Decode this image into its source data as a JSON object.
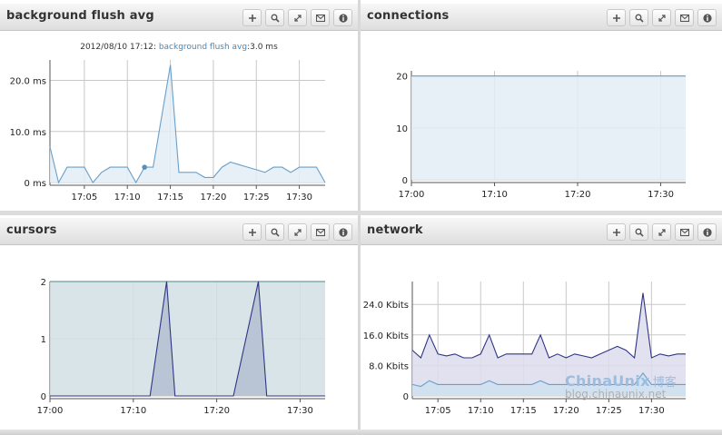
{
  "panels": {
    "flush": {
      "title": "background flush avg"
    },
    "connections": {
      "title": "connections"
    },
    "cursors": {
      "title": "cursors"
    },
    "network": {
      "title": "network"
    }
  },
  "tooltip": {
    "timestamp": "2012/08/10 17:12:",
    "series": "background flush avg",
    "value": ":3.0 ms"
  },
  "watermark": {
    "brand": "ChinaUnix",
    "brand_cn": "博客",
    "url": "blog.chinaunix.net"
  },
  "chart_data": [
    {
      "id": "flush",
      "type": "area",
      "title": "background flush avg",
      "color": "#6a9fc9",
      "fill": "#e3edf6",
      "x_ticks": [
        "17:05",
        "17:10",
        "17:15",
        "17:20",
        "17:25",
        "17:30"
      ],
      "y_ticks": [
        "0 ms",
        "10.0 ms",
        "20.0 ms"
      ],
      "ylim": [
        0,
        24
      ],
      "x": [
        0,
        1,
        2,
        3,
        4,
        5,
        6,
        7,
        8,
        9,
        10,
        11,
        12,
        13,
        14,
        15,
        16,
        17,
        18,
        19,
        20,
        21,
        22,
        23,
        24,
        25,
        26,
        27,
        28,
        29,
        30,
        31,
        32
      ],
      "values": [
        7,
        0,
        3,
        3,
        3,
        0,
        2,
        3,
        3,
        3,
        0,
        3,
        3,
        13,
        23,
        2,
        2,
        2,
        1,
        1,
        3,
        4,
        3.5,
        3,
        2.5,
        2,
        3,
        3,
        2,
        3,
        3,
        3,
        0
      ],
      "highlight": {
        "x": 11,
        "y": 3
      }
    },
    {
      "id": "connections",
      "type": "area",
      "title": "connections",
      "color": "#6a9fc9",
      "fill": "#e3edf6",
      "x_ticks": [
        "17:00",
        "17:10",
        "17:20",
        "17:30"
      ],
      "y_ticks": [
        "0",
        "10",
        "20"
      ],
      "ylim": [
        0,
        21
      ],
      "x": [
        0,
        33
      ],
      "values": [
        20,
        20
      ]
    },
    {
      "id": "cursors",
      "type": "area",
      "title": "cursors",
      "x_ticks": [
        "17:00",
        "17:10",
        "17:20",
        "17:30"
      ],
      "y_ticks": [
        "0",
        "1",
        "2"
      ],
      "ylim": [
        0,
        2
      ],
      "series": [
        {
          "color": "#4f8a8a",
          "fill": "#d1dfe3",
          "x": [
            0,
            33
          ],
          "values": [
            2,
            2
          ]
        },
        {
          "color": "#2f3584",
          "fill": "#b4bfd0",
          "x": [
            0,
            12,
            14,
            15,
            22,
            25,
            26,
            33
          ],
          "values": [
            0,
            0,
            2,
            0,
            0,
            2,
            0,
            0
          ]
        }
      ]
    },
    {
      "id": "network",
      "type": "area",
      "title": "network",
      "x_ticks": [
        "17:05",
        "17:10",
        "17:15",
        "17:20",
        "17:25",
        "17:30"
      ],
      "y_ticks": [
        "0",
        "8.0 Kbits",
        "16.0 Kbits",
        "24.0 Kbits"
      ],
      "ylim": [
        0,
        30
      ],
      "series": [
        {
          "color": "#2f3584",
          "fill": "#dcdcec",
          "x": [
            0,
            1,
            2,
            3,
            4,
            5,
            6,
            7,
            8,
            9,
            10,
            11,
            12,
            13,
            14,
            15,
            16,
            17,
            18,
            19,
            20,
            21,
            22,
            23,
            24,
            25,
            26,
            27,
            28,
            29,
            30,
            31,
            32
          ],
          "values": [
            12,
            10,
            16,
            11,
            10.5,
            11,
            10,
            10,
            11,
            16,
            10,
            11,
            11,
            11,
            11,
            16,
            10,
            11,
            10,
            11,
            10.5,
            10,
            11,
            12,
            13,
            12,
            10,
            27,
            10,
            11,
            10.5,
            11,
            11
          ]
        },
        {
          "color": "#6a9fc9",
          "fill": "#cfe0ef",
          "x": [
            0,
            1,
            2,
            3,
            4,
            5,
            6,
            7,
            8,
            9,
            10,
            11,
            12,
            13,
            14,
            15,
            16,
            17,
            18,
            19,
            20,
            21,
            22,
            23,
            24,
            25,
            26,
            27,
            28,
            29,
            30,
            31,
            32
          ],
          "values": [
            3,
            2.5,
            4,
            3,
            3,
            3,
            3,
            3,
            3,
            4,
            3,
            3,
            3,
            3,
            3,
            4,
            3,
            3,
            3,
            3,
            3,
            3,
            3,
            3,
            3,
            3,
            3,
            6,
            3,
            3,
            3,
            3,
            3
          ]
        }
      ]
    }
  ]
}
